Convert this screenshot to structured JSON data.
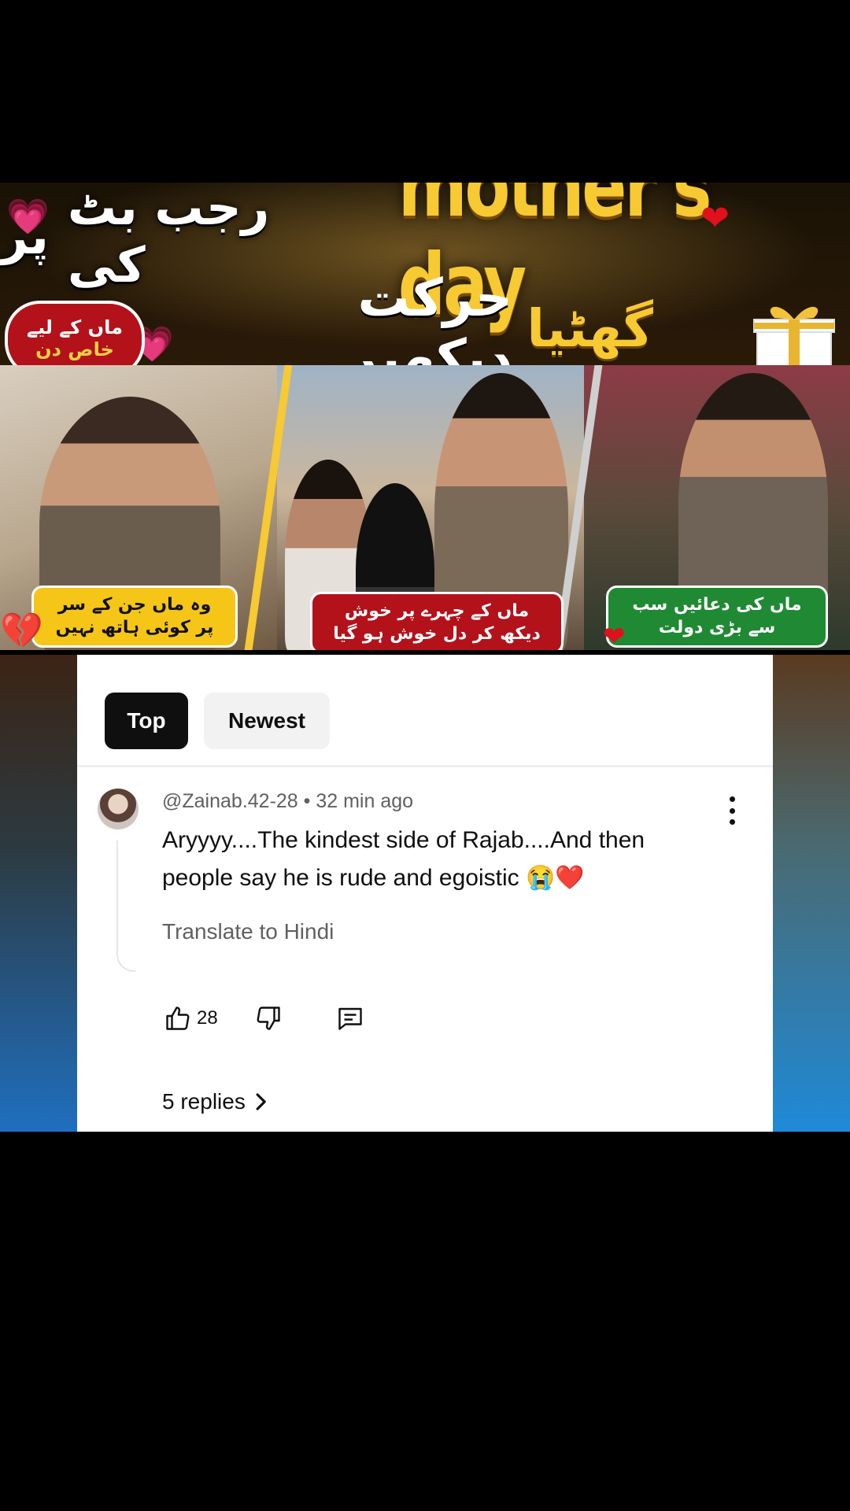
{
  "thumbnail": {
    "title_english": "mother's day",
    "title_urdu_left": "رجب بٹ کی",
    "title_urdu_right": "پر",
    "subtitle_gold": "گھٹیا",
    "subtitle_white": "حرکت دیکھیں",
    "badge_line1": "ماں کے لیے",
    "badge_line2": "خاص دن",
    "caption_left": "وہ ماں جن کے سر پر کوئی ہاتھ نہیں",
    "caption_middle": "ماں کے چہرے پر خوش دیکھ کر دل خوش ہو گیا",
    "caption_right": "ماں کی دعائیں سب سے بڑی دولت"
  },
  "comments": {
    "sort_chips": [
      {
        "label": "Top",
        "selected": true
      },
      {
        "label": "Newest",
        "selected": false
      }
    ],
    "comment": {
      "author": "@Zainab.42-28",
      "time": "32 min ago",
      "meta": "@Zainab.42-28 • 32 min ago",
      "text": "Aryyyy....The kindest side of Rajab....And then people say he is rude and egoistic 😭❤️",
      "translate_label": "Translate to Hindi",
      "like_count": "28",
      "replies_label": "5 replies"
    }
  },
  "colors": {
    "gold": "#f7c933",
    "badge_red": "#b3121b",
    "caption_green": "#1f8a33",
    "chip_selected": "#0f0f0f",
    "chip_unselected": "#f2f2f2"
  },
  "icons": [
    "thumbs-up-icon",
    "thumbs-down-icon",
    "reply-icon",
    "more-vert-icon",
    "chevron-right-icon",
    "heart-icon",
    "gift-icon",
    "broken-heart-icon"
  ]
}
